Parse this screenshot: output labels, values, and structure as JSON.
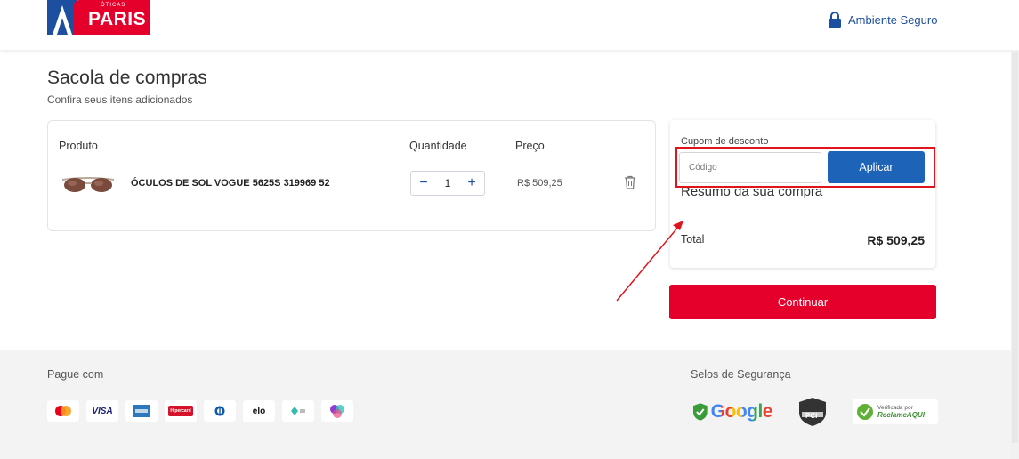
{
  "header": {
    "logo_small": "ÓTICAS",
    "logo_brand": "PARIS",
    "secure_label": "Ambiente Seguro"
  },
  "main": {
    "title": "Sacola de compras",
    "subtitle": "Confira seus itens adicionados"
  },
  "cart": {
    "columns": {
      "product": "Produto",
      "quantity": "Quantidade",
      "price": "Preço"
    },
    "items": [
      {
        "name": "ÓCULOS DE SOL VOGUE 5625S 319969 52",
        "quantity": "1",
        "price": "R$ 509,25"
      }
    ],
    "minus": "−",
    "plus": "+"
  },
  "summary": {
    "coupon_label": "Cupom de desconto",
    "coupon_placeholder": "Código",
    "apply_label": "Aplicar",
    "title": "Resumo da sua compra",
    "total_label": "Total",
    "total_value": "R$ 509,25"
  },
  "continue_label": "Continuar",
  "footer": {
    "pay_label": "Pague com",
    "seals_label": "Selos de Segurança",
    "payments": [
      "mastercard-icon",
      "visa-icon",
      "amex-icon",
      "hipercard-icon",
      "diners-icon",
      "elo-icon",
      "pix-icon",
      "hiper-icon"
    ],
    "visa_text": "VISA",
    "elo_text": "elo",
    "hipercard_text": "Hipercard",
    "google_text": "Google",
    "ra_text_1": "Verificada por",
    "ra_text_2": "ReclameAQUI",
    "pci_text": "PCI"
  },
  "colors": {
    "brand_red": "#e4002b",
    "brand_blue": "#1d4fa0",
    "apply_blue": "#1d64b8",
    "highlight_red": "#e0141c"
  }
}
